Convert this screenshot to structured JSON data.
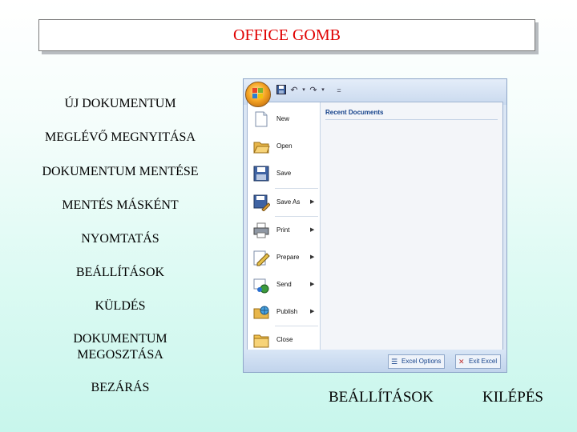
{
  "slide": {
    "title": "OFFICE GOMB",
    "labels": [
      "ÚJ DOKUMENTUM",
      "MEGLÉVŐ MEGNYITÁSA",
      "DOKUMENTUM MENTÉSE",
      "MENTÉS MÁSKÉNT",
      "NYOMTATÁS",
      "BEÁLLÍTÁSOK",
      "KÜLDÉS",
      "DOKUMENTUM\nMEGOSZTÁSA",
      "BEZÁRÁS"
    ],
    "bottom_left": "BEÁLLÍTÁSOK",
    "bottom_right": "KILÉPÉS"
  },
  "office_menu": {
    "recent_title": "Recent Documents",
    "items": [
      {
        "label": "New",
        "icon": "new-document-icon",
        "arrow": false
      },
      {
        "label": "Open",
        "icon": "open-folder-icon",
        "arrow": false
      },
      {
        "label": "Save",
        "icon": "save-disk-icon",
        "arrow": false
      },
      {
        "label": "Save As",
        "icon": "save-as-icon",
        "arrow": true
      },
      {
        "label": "Print",
        "icon": "printer-icon",
        "arrow": true
      },
      {
        "label": "Prepare",
        "icon": "prepare-pencil-icon",
        "arrow": true
      },
      {
        "label": "Send",
        "icon": "send-icon",
        "arrow": true
      },
      {
        "label": "Publish",
        "icon": "publish-icon",
        "arrow": true
      },
      {
        "label": "Close",
        "icon": "close-folder-icon",
        "arrow": false
      }
    ],
    "footer": {
      "options_label": "Excel Options",
      "exit_label": "Exit Excel"
    },
    "qat_separator": "="
  },
  "colors": {
    "title": "#e00000",
    "menu_text_blue": "#15428b"
  }
}
